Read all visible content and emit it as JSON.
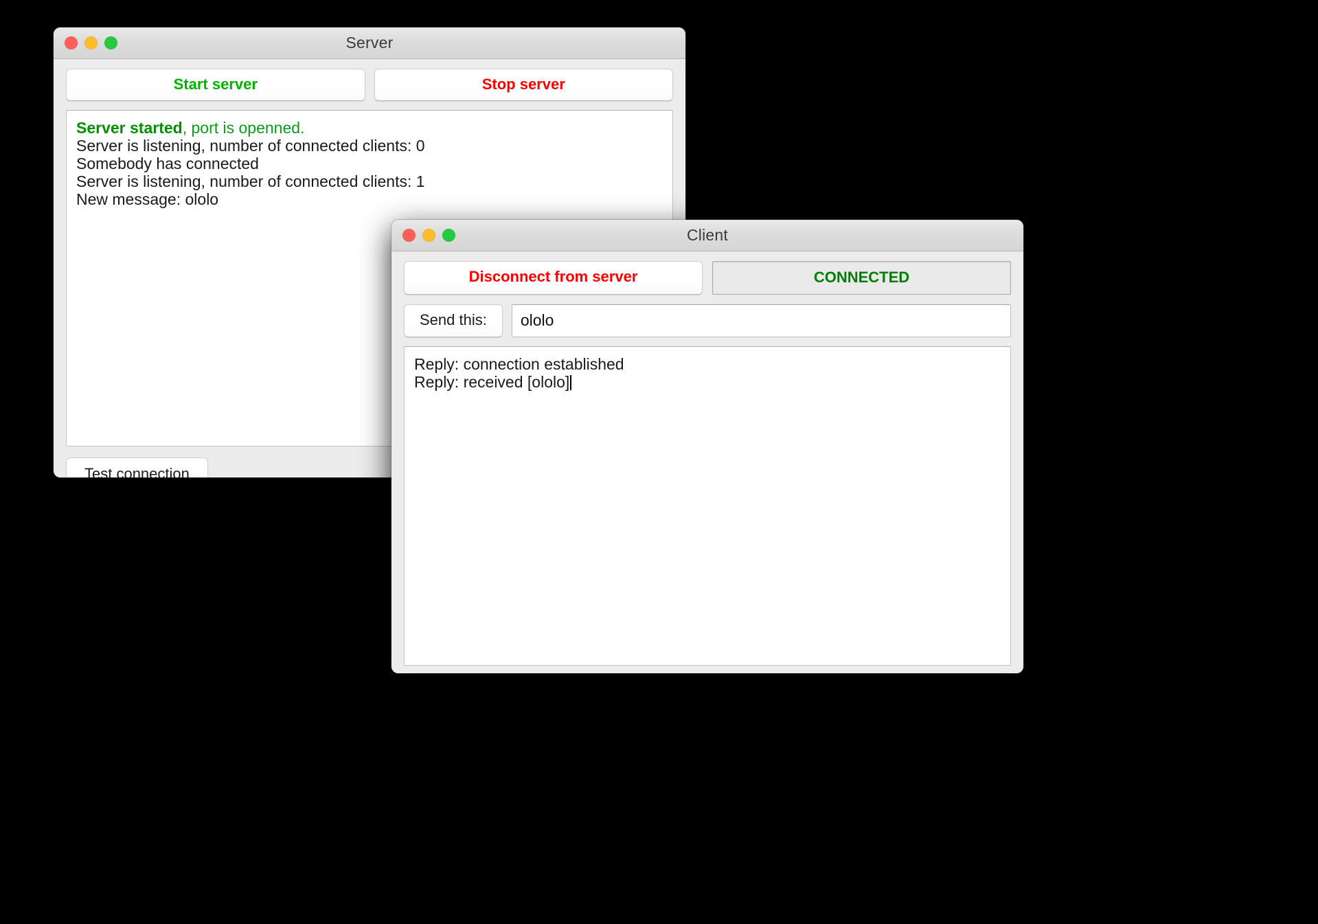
{
  "server_window": {
    "title": "Server",
    "traffic_lights": [
      {
        "name": "close-button",
        "color": "#ff5f56"
      },
      {
        "name": "minimize-button",
        "color": "#ffbd2e"
      },
      {
        "name": "maximize-button",
        "color": "#27c93f"
      }
    ],
    "start_button": "Start server",
    "stop_button": "Stop server",
    "start_color": "#00b200",
    "stop_color": "#ff0000",
    "log": [
      {
        "bold_prefix": "Server started",
        "rest": ", port is openned.",
        "color": "green"
      },
      {
        "text": "Server is listening, number of connected clients: 0",
        "color": "black"
      },
      {
        "text": "Somebody has connected",
        "color": "black"
      },
      {
        "text": "Server is listening, number of connected clients: 1",
        "color": "black"
      },
      {
        "text": "New message: ololo",
        "color": "black"
      }
    ],
    "test_connection_button": "Test connection"
  },
  "client_window": {
    "title": "Client",
    "traffic_lights": [
      {
        "name": "close-button",
        "color": "#ff5f56"
      },
      {
        "name": "minimize-button",
        "color": "#ffbd2e"
      },
      {
        "name": "maximize-button",
        "color": "#27c93f"
      }
    ],
    "disconnect_button": "Disconnect from server",
    "disconnect_color": "#ff0000",
    "status_value": "CONNECTED",
    "status_color": "#008000",
    "send_button": "Send this:",
    "message_input_value": "ololo",
    "message_input_placeholder": "",
    "log": [
      {
        "text": "Reply: connection established"
      },
      {
        "text": "Reply: received [ololo]"
      }
    ]
  }
}
